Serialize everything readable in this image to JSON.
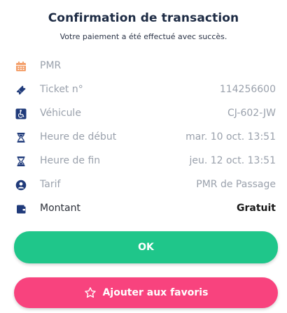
{
  "dialog": {
    "title": "Confirmation de transaction",
    "subtitle": "Votre paiement a été effectué avec succès."
  },
  "rows": [
    {
      "icon": "calendar-icon",
      "label": "PMR",
      "value": ""
    },
    {
      "icon": "ticket-icon",
      "label": "Ticket n°",
      "value": "114256600"
    },
    {
      "icon": "wheelchair-icon",
      "label": "Véhicule",
      "value": "CJ-602-JW"
    },
    {
      "icon": "hourglass-start-icon",
      "label": "Heure de début",
      "value": "mar. 10 oct. 13:51"
    },
    {
      "icon": "hourglass-end-icon",
      "label": "Heure de fin",
      "value": "jeu. 12 oct. 13:51"
    },
    {
      "icon": "user-circle-icon",
      "label": "Tarif",
      "value": "PMR de Passage"
    },
    {
      "icon": "wallet-icon",
      "label": "Montant",
      "value": "Gratuit"
    }
  ],
  "buttons": {
    "ok_label": "OK",
    "favorite_label": "Ajouter aux favoris"
  },
  "colors": {
    "title": "#1d2b44",
    "icon_orange": "#f4a06b",
    "icon_navy": "#1f3a7a",
    "ok_green": "#1fc68a",
    "favorite_pink": "#f8437e",
    "label_gray": "#9aa1ac"
  }
}
